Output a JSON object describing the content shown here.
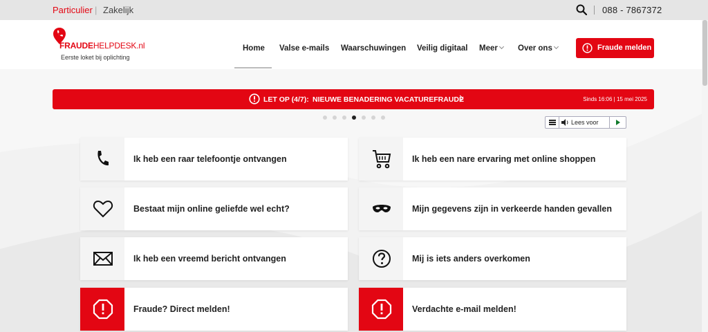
{
  "topbar": {
    "segment_active": "Particulier",
    "segment_separator": "|",
    "segment_other": "Zakelijk",
    "search_icon": "search-icon",
    "phone": "088 - 7867372"
  },
  "logo": {
    "part1": "FRAUDE",
    "part2": "HELPDESK",
    "part3": ".nl",
    "tagline": "Eerste loket bij oplichting"
  },
  "nav": {
    "items": [
      {
        "label": "Home",
        "active": true
      },
      {
        "label": "Valse e-mails"
      },
      {
        "label": "Waarschuwingen"
      },
      {
        "label": "Veilig digitaal"
      },
      {
        "label": "Meer",
        "dropdown": true
      },
      {
        "label": "Over ons",
        "dropdown": true
      }
    ],
    "report_button": "Fraude melden"
  },
  "banner": {
    "prefix": "LET OP (4/7):",
    "title": "NIEUWE BENADERING VACATUREFRAUDE",
    "date": "Sinds 16:06 | 15 mei 2025"
  },
  "carousel": {
    "total": 7,
    "active_index": 3
  },
  "readaloud": {
    "label": "Lees voor"
  },
  "cards": [
    {
      "icon": "phone-icon",
      "label": "Ik heb een raar telefoontje ontvangen"
    },
    {
      "icon": "shopping-cart-icon",
      "label": "Ik heb een nare ervaring met online shoppen"
    },
    {
      "icon": "heart-icon",
      "label": "Bestaat mijn online geliefde wel echt?"
    },
    {
      "icon": "mask-icon",
      "label": "Mijn gegevens zijn in verkeerde handen gevallen"
    },
    {
      "icon": "envelope-icon",
      "label": "Ik heb een vreemd bericht ontvangen"
    },
    {
      "icon": "question-icon",
      "label": "Mij is iets anders overkomen"
    },
    {
      "icon": "alert-octagon-icon",
      "label": "Fraude? Direct melden!"
    },
    {
      "icon": "alert-octagon-icon",
      "label": "Verdachte e-mail melden!"
    }
  ],
  "colors": {
    "brand_red": "#e30613",
    "text": "#222222",
    "background": "#f2f2f2"
  }
}
